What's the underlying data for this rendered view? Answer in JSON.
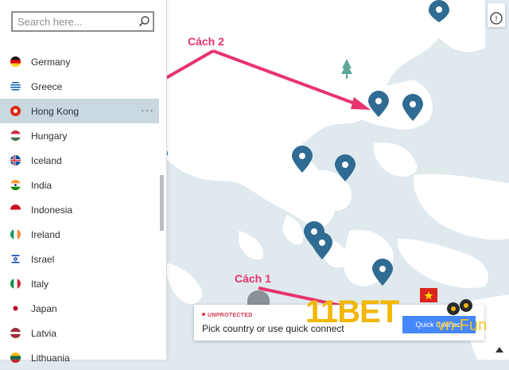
{
  "search": {
    "placeholder": "Search here..."
  },
  "countries": [
    {
      "name": "Germany",
      "flag": "germany-flag-icon"
    },
    {
      "name": "Greece",
      "flag": "greece-flag-icon"
    },
    {
      "name": "Hong Kong",
      "flag": "hong-kong-flag-icon",
      "selected": true
    },
    {
      "name": "Hungary",
      "flag": "hungary-flag-icon"
    },
    {
      "name": "Iceland",
      "flag": "iceland-flag-icon"
    },
    {
      "name": "India",
      "flag": "india-flag-icon"
    },
    {
      "name": "Indonesia",
      "flag": "indonesia-flag-icon"
    },
    {
      "name": "Ireland",
      "flag": "ireland-flag-icon"
    },
    {
      "name": "Israel",
      "flag": "israel-flag-icon"
    },
    {
      "name": "Italy",
      "flag": "italy-flag-icon"
    },
    {
      "name": "Japan",
      "flag": "japan-flag-icon"
    },
    {
      "name": "Latvia",
      "flag": "latvia-flag-icon"
    },
    {
      "name": "Lithuania",
      "flag": "lithuania-flag-icon"
    }
  ],
  "selected_item": {
    "more_label": "···"
  },
  "status": {
    "label": "UNPROTECTED",
    "message": "Pick country or use quick connect",
    "button": "Quick Connect"
  },
  "annotations": {
    "method1": "Cách 1",
    "method2": "Cách 2"
  },
  "watermark": {
    "brand": "11BET",
    "suffix": "vn-Fun"
  },
  "map": {
    "info_label": "!"
  },
  "colors": {
    "accent": "#4687ff",
    "pin": "#2f6b93",
    "annotation": "#e8336c",
    "unprotected": "#d3364f",
    "land": "#ffffff",
    "sea": "#dfe9ee"
  }
}
